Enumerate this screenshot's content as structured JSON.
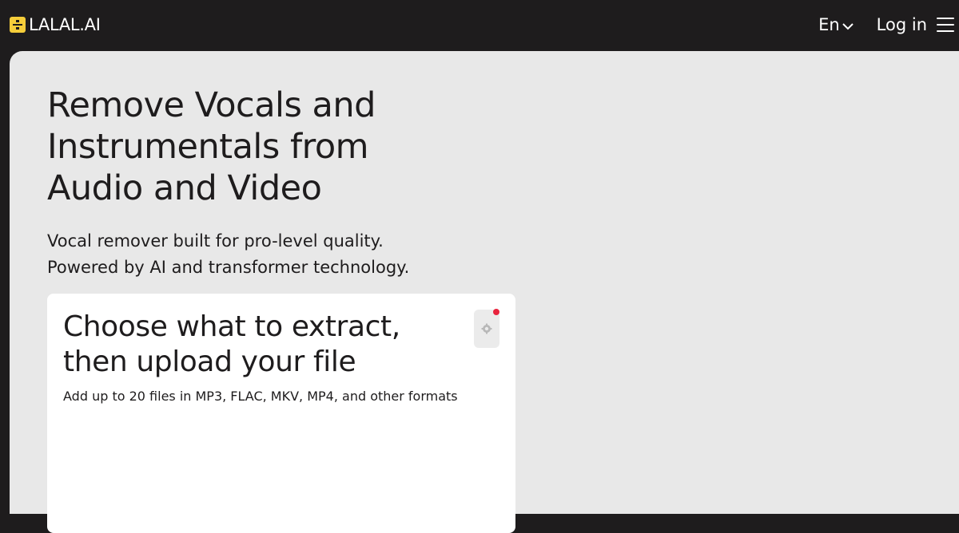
{
  "header": {
    "logo_text": "LALAL.AI",
    "language_label": "En",
    "login_label": "Log in"
  },
  "hero": {
    "title_lines": [
      "Remove Vocals and",
      "Instrumentals from",
      "Audio and Video"
    ],
    "subtitle_lines": [
      "Vocal remover built for pro-level quality.",
      "Powered by AI and transformer technology."
    ]
  },
  "upload_card": {
    "title_lines": [
      "Choose what to extract,",
      "then upload your file"
    ],
    "subtitle": "Add up to 20 files in MP3, FLAC, MKV, MP4, and other formats"
  },
  "colors": {
    "header_bg": "#1e1c1d",
    "page_bg": "#e8e8e8",
    "logo_yellow": "#f5cd3a",
    "notification_red": "#e8233d"
  },
  "icons": {
    "logo": "lalal-logo-icon",
    "language": "chevron-down-icon",
    "menu": "hamburger-menu-icon",
    "settings": "gear-icon"
  }
}
